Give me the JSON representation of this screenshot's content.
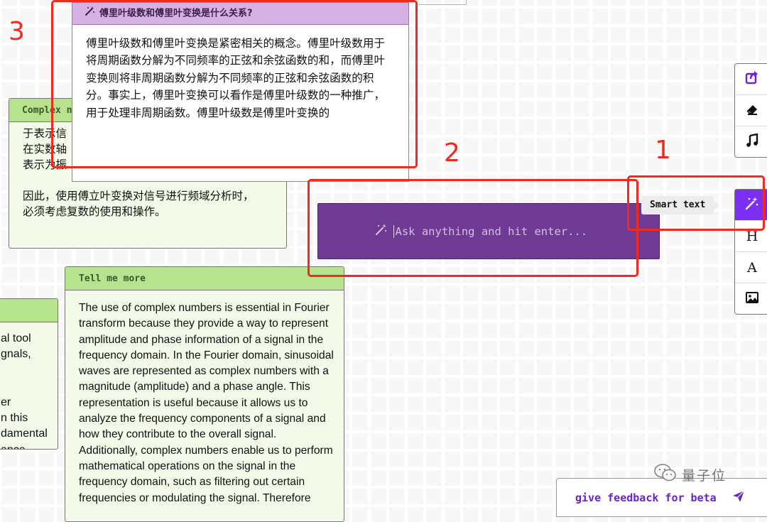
{
  "canvas": {
    "complex_card": {
      "title": "Complex n",
      "lines": [
        "于表示信",
        "在实数轴",
        "表示为振",
        "",
        "因此，使用傅立叶变换对信号进行频域分析时，",
        "必须考虑复数的使用和操作。"
      ]
    },
    "left_card": {
      "title": "",
      "lines": [
        "al tool",
        "gnals,",
        "",
        "",
        "er",
        "n this",
        "damental",
        "ance."
      ]
    },
    "tell_card": {
      "title": "Tell me more",
      "body": "The use of complex numbers is essential in Fourier transform because they provide a way to represent amplitude and phase information of a signal in the frequency domain. In the Fourier domain, sinusoidal waves are represented as complex numbers with a magnitude (amplitude) and a phase angle. This representation is useful because it allows us to analyze the frequency components of a signal and how they contribute to the overall signal. Additionally, complex numbers enable us to perform mathematical operations on the signal in the frequency domain, such as filtering out certain frequencies or modulating the signal. Therefore"
    },
    "popup": {
      "title": "傅里叶级数和傅里叶变换是什么关系?",
      "body": "傅里叶级数和傅里叶变换是紧密相关的概念。傅里叶级数用于将周期函数分解为不同频率的正弦和余弦函数的和，而傅里叶变换则将非周期函数分解为不同频率的正弦和余弦函数的积分。事实上，傅里叶变换可以看作是傅里叶级数的一种推广，用于处理非周期函数。傅里叶级数是傅里叶变换的"
    },
    "ask_bar": {
      "placeholder": "Ask anything and hit enter...",
      "icon": "magic-wand-icon"
    }
  },
  "toolbar_top": {
    "items": [
      {
        "icon": "share-icon"
      },
      {
        "icon": "eraser-icon"
      },
      {
        "icon": "music-note-icon"
      }
    ]
  },
  "toolbar_bottom": {
    "items": [
      {
        "icon": "magic-wand-icon",
        "active": true
      },
      {
        "icon": "heading-icon",
        "label": "H"
      },
      {
        "icon": "font-icon",
        "label": "A"
      },
      {
        "icon": "image-icon"
      }
    ]
  },
  "tooltip": {
    "text": "Smart text"
  },
  "feedback": {
    "label": "give feedback for beta",
    "icon": "send-icon"
  },
  "watermark": {
    "text": "量子位"
  },
  "annotations": [
    "1",
    "2",
    "3"
  ],
  "colors": {
    "accent": "#7a2ff2",
    "ask_bar": "#6f3a93",
    "card_header": "#b7e38f",
    "popup_header": "#d6b1e4",
    "annotation": "#f02a1e"
  }
}
